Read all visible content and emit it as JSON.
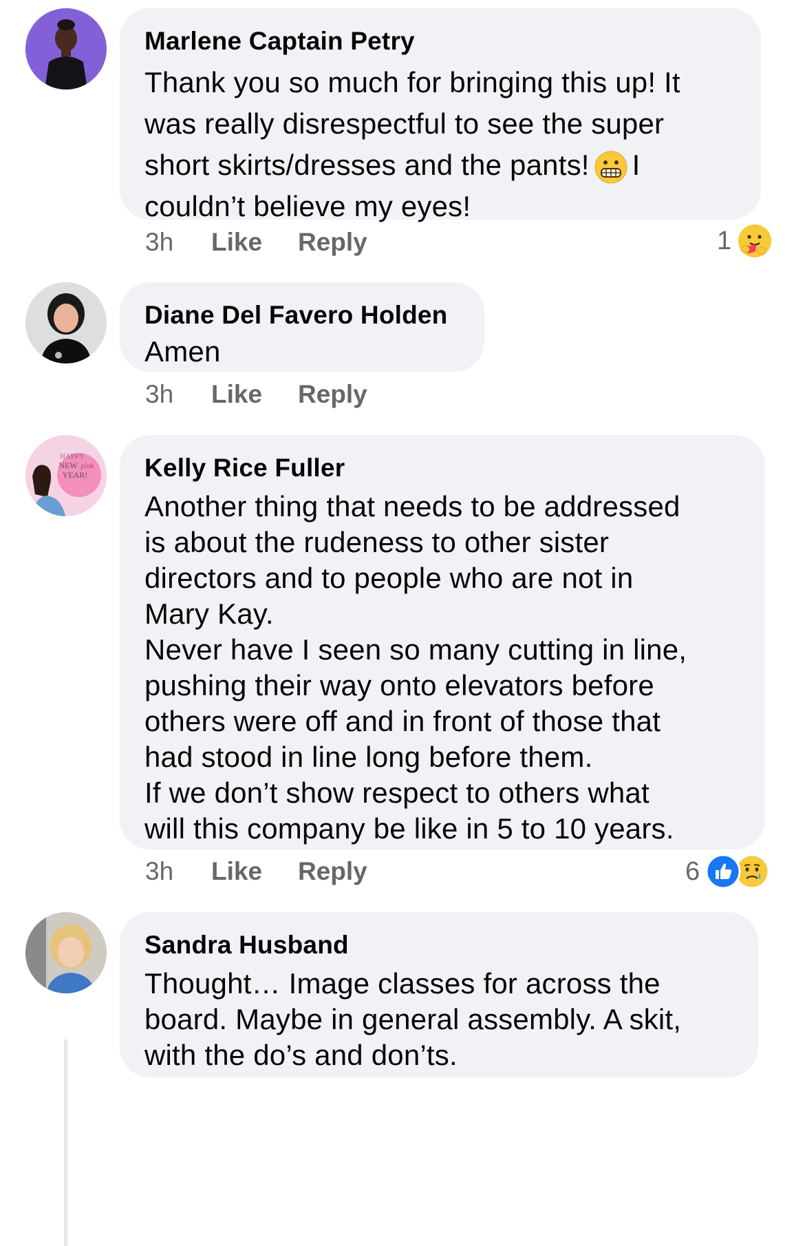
{
  "comments": [
    {
      "author": "Marlene Captain Petry",
      "text_part1": "Thank you so much for bringing this up! It\nwas really disrespectful to see the super\nshort skirts/dresses and the pants!",
      "text_part2": "I",
      "text_part3": "couldn’t believe my eyes!",
      "inline_emoji": "grimacing-face-emoji",
      "time": "3h",
      "like_label": "Like",
      "reply_label": "Reply",
      "reaction_count": "1",
      "reactions": [
        "care"
      ]
    },
    {
      "author": "Diane Del Favero Holden",
      "text": "Amen",
      "time": "3h",
      "like_label": "Like",
      "reply_label": "Reply"
    },
    {
      "author": "Kelly Rice Fuller",
      "text": "Another thing that needs to be addressed\nis about the rudeness to other sister\ndirectors and to people who are not in\nMary Kay.\nNever have I seen so many cutting in line,\npushing their way onto elevators before\nothers were off and in front of those that\nhad stood in line long before them.\nIf we don’t show respect to others what\nwill this company be like in 5 to 10 years.",
      "avatar_text": [
        "HAPPY",
        "NEW",
        "pink",
        "YEAR!"
      ],
      "time": "3h",
      "like_label": "Like",
      "reply_label": "Reply",
      "reaction_count": "6",
      "reactions": [
        "like",
        "sad"
      ]
    },
    {
      "author": "Sandra Husband",
      "text": "Thought… Image classes for across the\nboard. Maybe in general assembly. A skit,\nwith the do’s and don’ts."
    }
  ],
  "colors": {
    "bubble": "#f0f2f5",
    "secondary_text": "#65676b",
    "like_blue": "#1877f2",
    "emoji_yellow": "#f7c93b"
  }
}
